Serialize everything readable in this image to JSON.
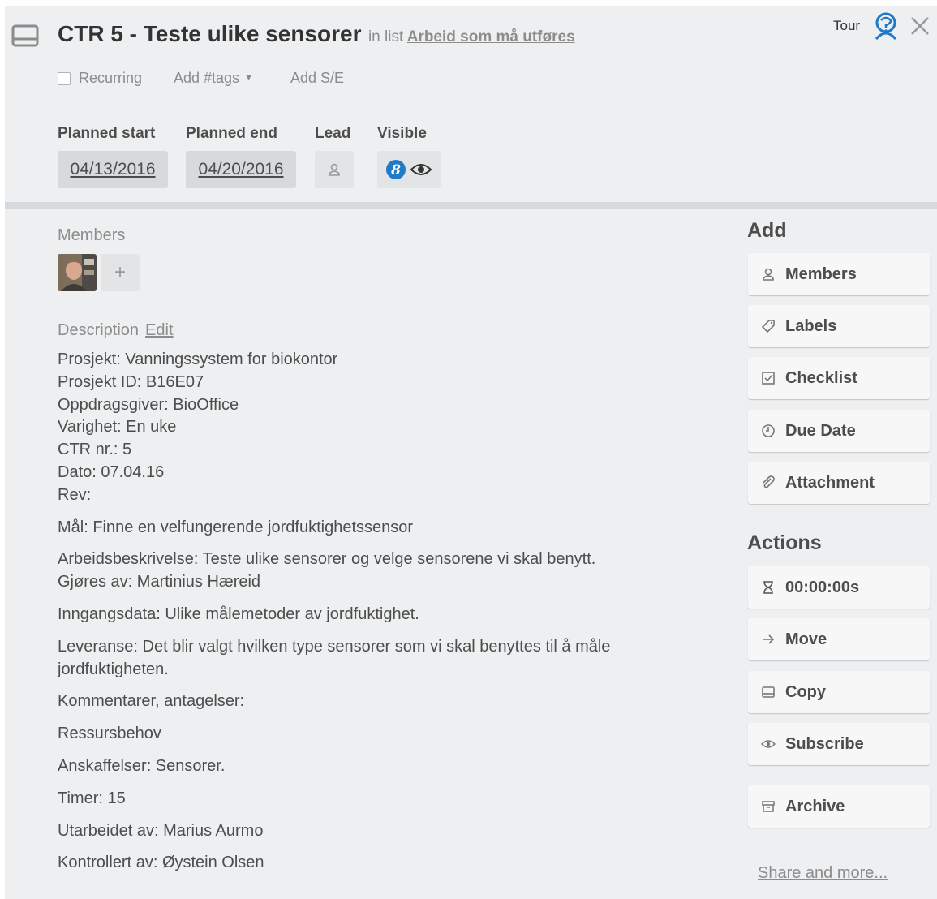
{
  "header": {
    "title": "CTR 5 - Teste ulike sensorer",
    "in_list_prefix": "in list",
    "list_name": "Arbeid som må utføres",
    "tour_label": "Tour"
  },
  "options": {
    "recurring_label": "Recurring",
    "tags_label": "Add #tags",
    "se_label": "Add S/E"
  },
  "fields": {
    "planned_start_label": "Planned start",
    "planned_start_value": "04/13/2016",
    "planned_end_label": "Planned end",
    "planned_end_value": "04/20/2016",
    "lead_label": "Lead",
    "visible_label": "Visible"
  },
  "members": {
    "label": "Members",
    "add_symbol": "+"
  },
  "description": {
    "label": "Description",
    "edit_label": "Edit",
    "lines": [
      "Prosjekt: Vanningssystem for biokontor",
      "Prosjekt ID: B16E07",
      "Oppdragsgiver: BioOffice",
      "Varighet: En uke",
      "CTR nr.: 5",
      "Dato: 07.04.16",
      "Rev:"
    ],
    "goal": "Mål: Finne en velfungerende jordfuktighetssensor",
    "work_desc_1": "Arbeidsbeskrivelse: Teste ulike sensorer og velge sensorene vi skal benytt.",
    "work_desc_2": "Gjøres av: Martinius Hæreid",
    "input": "Inngangsdata: Ulike målemetoder av jordfuktighet.",
    "delivery": "Leveranse: Det blir valgt hvilken type sensorer som vi skal benyttes til å måle jordfuktigheten.",
    "comments": "Kommentarer, antagelser:",
    "resources": "Ressursbehov",
    "acquisitions": "Anskaffelser: Sensorer.",
    "hours": "Timer: 15",
    "prepared_by": "Utarbeidet av: Marius Aurmo",
    "checked_by": "Kontrollert av: Øystein Olsen"
  },
  "sidebar": {
    "add_heading": "Add",
    "add_buttons": {
      "members": "Members",
      "labels": "Labels",
      "checklist": "Checklist",
      "due_date": "Due Date",
      "attachment": "Attachment"
    },
    "actions_heading": "Actions",
    "action_buttons": {
      "timer": "00:00:00s",
      "move": "Move",
      "copy": "Copy",
      "subscribe": "Subscribe",
      "archive": "Archive"
    },
    "share_label": "Share and more..."
  },
  "colors": {
    "background": "#edeff0",
    "button_bg": "#f7f7f7",
    "field_bg": "#d6dadc",
    "visible_badge": "#1f7bc9"
  },
  "icons": {
    "card": "card-icon",
    "tour": "tour-icon",
    "close": "close-icon",
    "lead": "person-icon",
    "visible": [
      "visibility-badge-icon",
      "eye-icon"
    ]
  }
}
